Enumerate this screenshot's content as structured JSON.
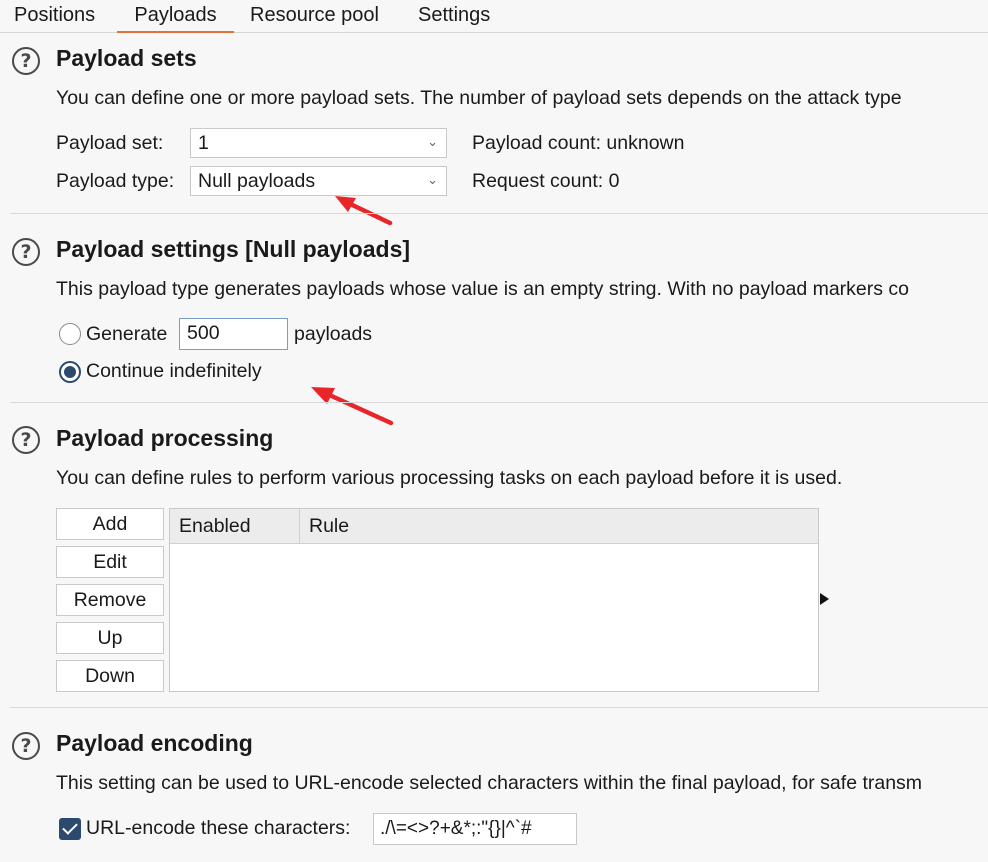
{
  "tabs": [
    "Positions",
    "Payloads",
    "Resource pool",
    "Settings"
  ],
  "help_glyph": "?",
  "payload_sets": {
    "title": "Payload sets",
    "description": "You can define one or more payload sets. The number of payload sets depends on the attack type",
    "set_label": "Payload set:",
    "set_value": "1",
    "type_label": "Payload type:",
    "type_value": "Null payloads",
    "payload_count": "Payload count: unknown",
    "request_count": "Request count: 0"
  },
  "payload_settings": {
    "title": "Payload settings [Null payloads]",
    "description": "This payload type generates payloads whose value is an empty string. With no payload markers co",
    "generate_label": "Generate",
    "generate_value": "500",
    "payloads_suffix": "payloads",
    "continue_label": "Continue indefinitely",
    "selected": "continue"
  },
  "payload_processing": {
    "title": "Payload processing",
    "description": "You can define rules to perform various processing tasks on each payload before it is used.",
    "buttons": [
      "Add",
      "Edit",
      "Remove",
      "Up",
      "Down"
    ],
    "columns": [
      "Enabled",
      "Rule"
    ]
  },
  "payload_encoding": {
    "title": "Payload encoding",
    "description": "This setting can be used to URL-encode selected characters within the final payload, for safe transm",
    "checkbox_label": "URL-encode these characters:",
    "checked": true,
    "characters": "./\\=<>?+&*;:\"{}|^`#"
  },
  "colors": {
    "accent": "#e8703a",
    "arrow": "#e8262a",
    "radio": "#2c4a6e"
  },
  "icons": {
    "help": "help-circle-icon",
    "dropdown": "chevron-down-icon",
    "expand": "triangle-right-icon"
  }
}
